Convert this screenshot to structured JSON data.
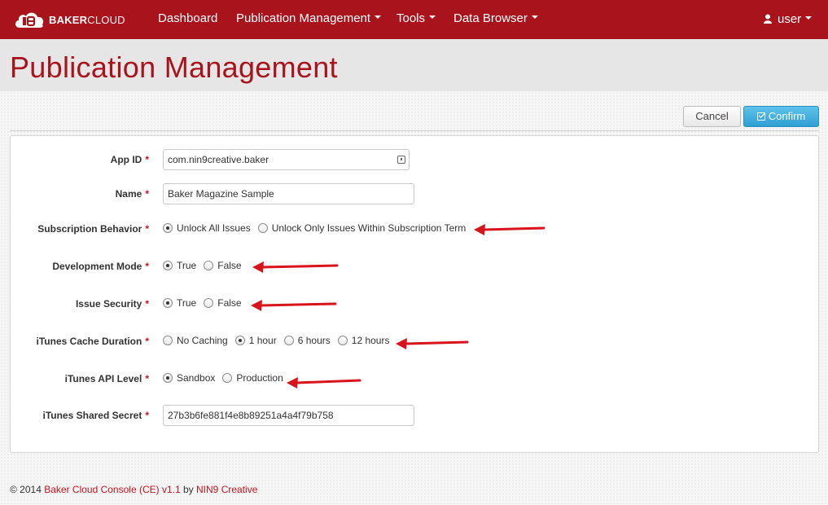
{
  "colors": {
    "brand": "#a8131c",
    "accent": "#2f9fd3",
    "required": "#d0101c"
  },
  "navbar": {
    "brand_bold": "BAKER",
    "brand_light": "CLOUD",
    "items": [
      {
        "label": "Dashboard",
        "dropdown": false
      },
      {
        "label": "Publication Management",
        "dropdown": true
      },
      {
        "label": "Tools",
        "dropdown": true
      },
      {
        "label": "Data Browser",
        "dropdown": true
      }
    ],
    "user_label": "user"
  },
  "page": {
    "title": "Publication Management"
  },
  "actions": {
    "cancel_label": "Cancel",
    "confirm_label": "Confirm"
  },
  "form": {
    "required_marker": "*",
    "app_id": {
      "label": "App ID",
      "value": "com.nin9creative.baker"
    },
    "name": {
      "label": "Name",
      "value": "Baker Magazine Sample"
    },
    "subscription_behavior": {
      "label": "Subscription Behavior",
      "options": [
        {
          "label": "Unlock All Issues",
          "checked": true
        },
        {
          "label": "Unlock Only Issues Within Subscription Term",
          "checked": false
        }
      ]
    },
    "development_mode": {
      "label": "Development Mode",
      "options": [
        {
          "label": "True",
          "checked": true
        },
        {
          "label": "False",
          "checked": false
        }
      ]
    },
    "issue_security": {
      "label": "Issue Security",
      "options": [
        {
          "label": "True",
          "checked": true
        },
        {
          "label": "False",
          "checked": false
        }
      ]
    },
    "itunes_cache_duration": {
      "label": "iTunes Cache Duration",
      "options": [
        {
          "label": "No Caching",
          "checked": false
        },
        {
          "label": "1 hour",
          "checked": true
        },
        {
          "label": "6 hours",
          "checked": false
        },
        {
          "label": "12 hours",
          "checked": false
        }
      ]
    },
    "itunes_api_level": {
      "label": "iTunes API Level",
      "options": [
        {
          "label": "Sandbox",
          "checked": true
        },
        {
          "label": "Production",
          "checked": false
        }
      ]
    },
    "itunes_shared_secret": {
      "label": "iTunes Shared Secret",
      "value": "27b3b6fe881f4e8b89251a4a4f79b758"
    }
  },
  "footer": {
    "copyright": "© 2014",
    "product_link": "Baker Cloud Console (CE) v1.1",
    "by_text": "by",
    "company_link": "NIN9 Creative"
  }
}
